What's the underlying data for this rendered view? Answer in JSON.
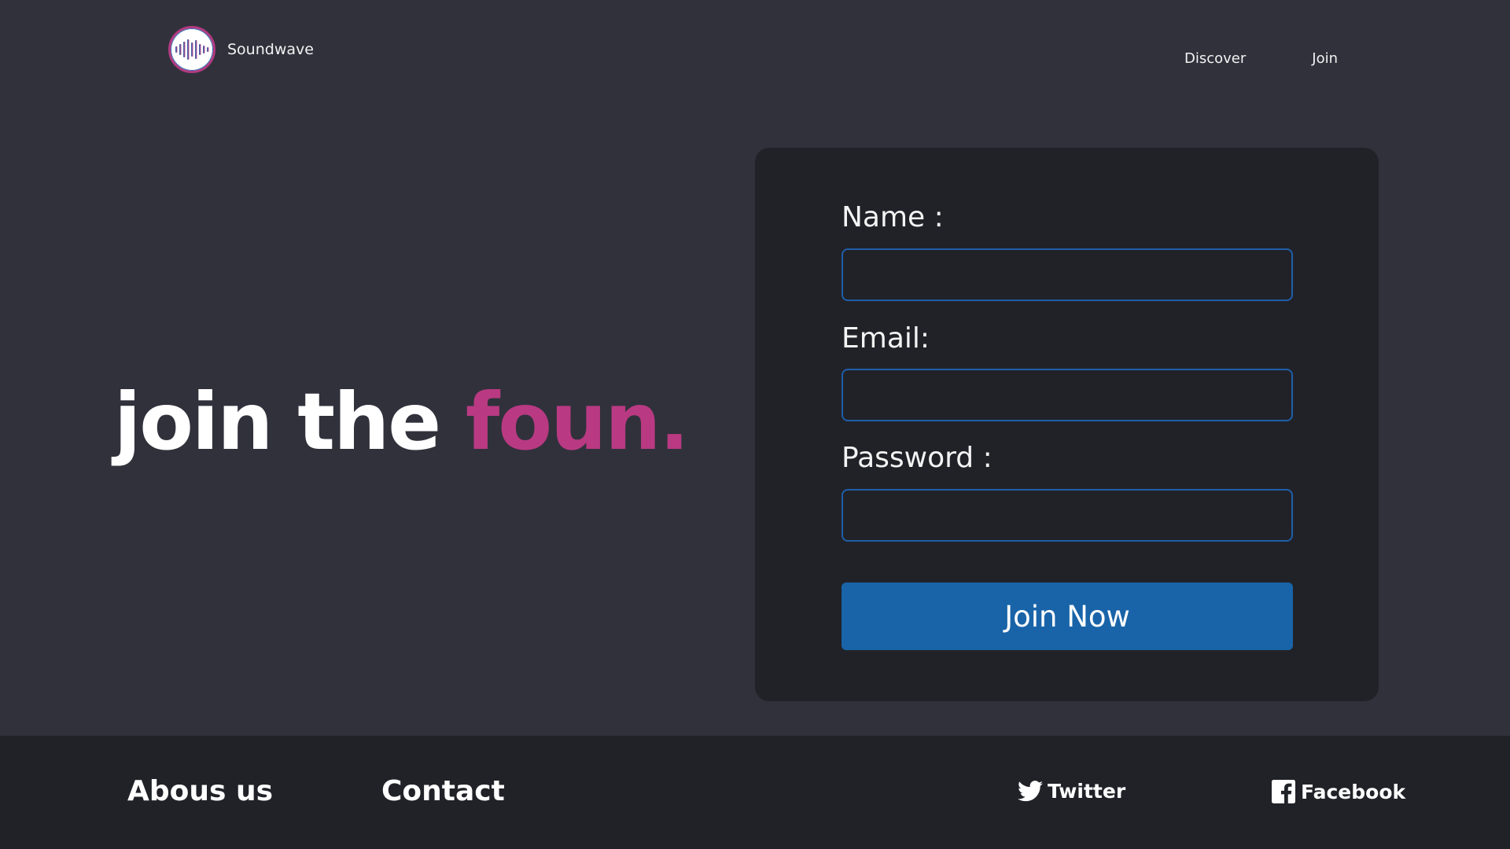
{
  "brand": {
    "name": "Soundwave",
    "icon": "soundwave-logo-icon"
  },
  "nav": {
    "discover": "Discover",
    "join": "Join"
  },
  "hero": {
    "text": "join the",
    "accent": "foun.",
    "accent_color": "#b93a82"
  },
  "form": {
    "name_label": "Name :",
    "name_value": "",
    "email_label": "Email:",
    "email_value": "",
    "password_label": "Password :",
    "password_value": "",
    "submit_label": "Join Now",
    "submit_color": "#1964a8"
  },
  "footer": {
    "about": "Abous us",
    "contact": "Contact",
    "twitter": "Twitter",
    "facebook": "Facebook"
  }
}
